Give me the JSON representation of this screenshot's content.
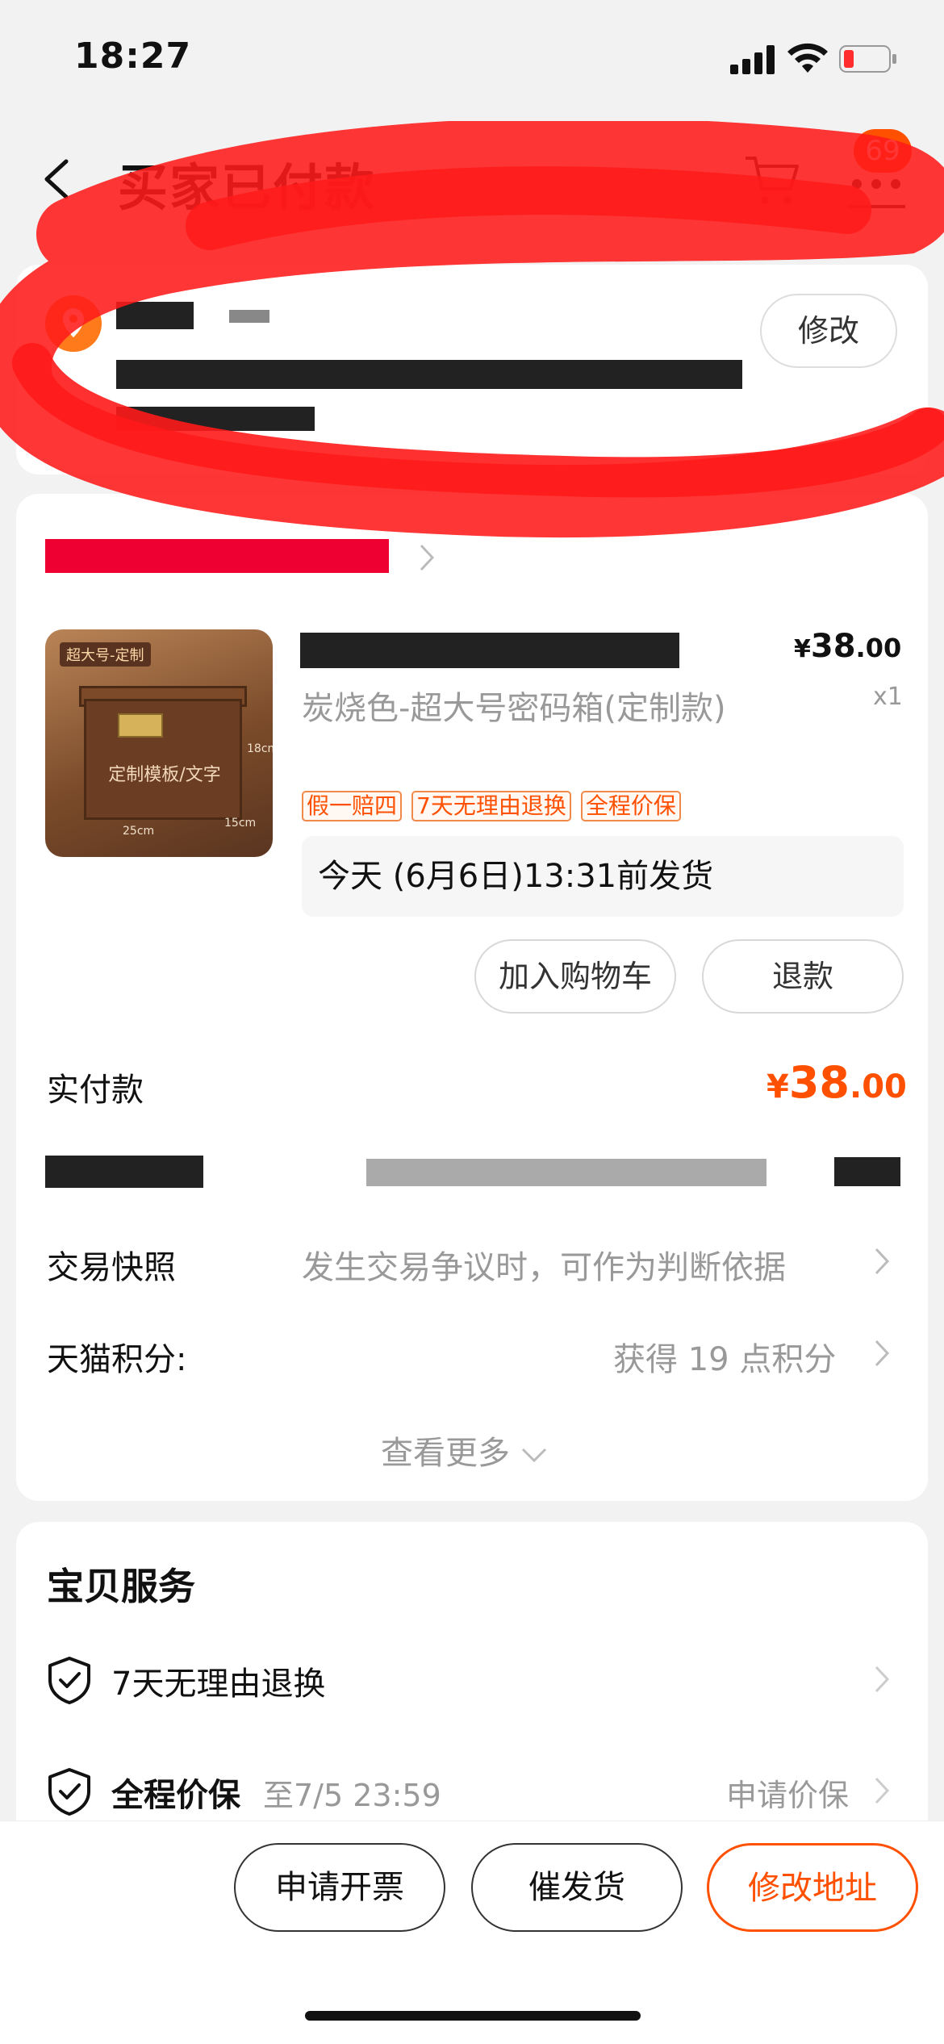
{
  "status_bar": {
    "time": "18:27"
  },
  "header": {
    "title": "买家已付款",
    "notification_count": "69"
  },
  "address": {
    "modify_label": "修改"
  },
  "item": {
    "thumbnail": {
      "tag": "超大号-定制",
      "engraving": "定制模板/文字",
      "dim_h": "18cm",
      "dim_w": "25cm",
      "dim_d": "15cm"
    },
    "price_currency": "¥",
    "price_int": "38",
    "price_dec": ".00",
    "quantity": "x1",
    "sku": "炭烧色-超大号密码箱(定制款)",
    "tags": [
      "假一赔四",
      "7天无理由退换",
      "全程价保"
    ],
    "shipping": "今天 (6月6日)13:31前发货",
    "add_to_cart": "加入购物车",
    "refund": "退款"
  },
  "payment": {
    "label": "实付款",
    "currency": "¥",
    "amount_int": "38",
    "amount_dec": ".00"
  },
  "snapshot": {
    "label": "交易快照",
    "value": "发生交易争议时，可作为判断依据"
  },
  "points": {
    "label": "天猫积分:",
    "value": "获得 19 点积分"
  },
  "see_more": "查看更多",
  "services": {
    "title": "宝贝服务",
    "items": [
      {
        "label": "7天无理由退换"
      },
      {
        "label": "全程价保",
        "sub": "至7/5 23:59",
        "action": "申请价保"
      }
    ]
  },
  "bottom_bar": {
    "invoice": "申请开票",
    "urge": "催发货",
    "modify_address": "修改地址"
  },
  "colors": {
    "accent": "#ff5000",
    "scribble": "#ff1a1a"
  }
}
